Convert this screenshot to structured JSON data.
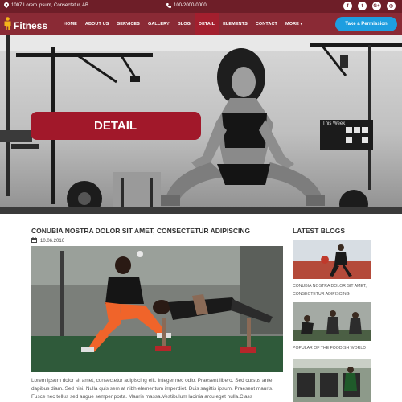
{
  "topbar": {
    "address": "1007 Lorem ipsum, Consectetur, AB",
    "phone": "100-2000-0000",
    "social": [
      "f",
      "t",
      "G+",
      "◎"
    ]
  },
  "brand": {
    "name": "Fitness"
  },
  "nav": {
    "items": [
      "HOME",
      "ABOUT US",
      "SERVICES",
      "GALLERY",
      "BLOG",
      "DETAIL",
      "ELEMENTS",
      "CONTACT",
      "MORE ▾"
    ],
    "active": "DETAIL",
    "cta": "Take a Permission"
  },
  "hero": {
    "banner": "DETAIL",
    "board_text": "This Week"
  },
  "article": {
    "title": "CONUBIA NOSTRA DOLOR SIT AMET, CONSECTETUR ADIPISCING",
    "date": "10.06.2016",
    "body": "Lorem ipsum dolor sit amet, consectetur adipiscing elit. Integer nec odio. Praesent libero. Sed cursus ante dapibus diam. Sed nisi. Nulla quis sem at nibh elementum imperdiet. Duis sagittis ipsum. Praesent mauris. Fusce nec tellus sed augue semper porta. Mauris massa.Vestibulum lacinia arcu eget nulla.Class"
  },
  "sidebar": {
    "title": "LATEST BLOGS",
    "posts": [
      {
        "caption": "CONUBIA NOSTRA DOLOR SIT AMET, CONSECTETUR ADIPISCING"
      },
      {
        "caption": "POPULAR OF THE FOODISH WORLD"
      },
      {
        "caption": ""
      }
    ]
  },
  "colors": {
    "topbar": "#6e1e28",
    "navbar": "#8a2a35",
    "accent": "#a1182a",
    "cta": "#1e9ee0"
  }
}
